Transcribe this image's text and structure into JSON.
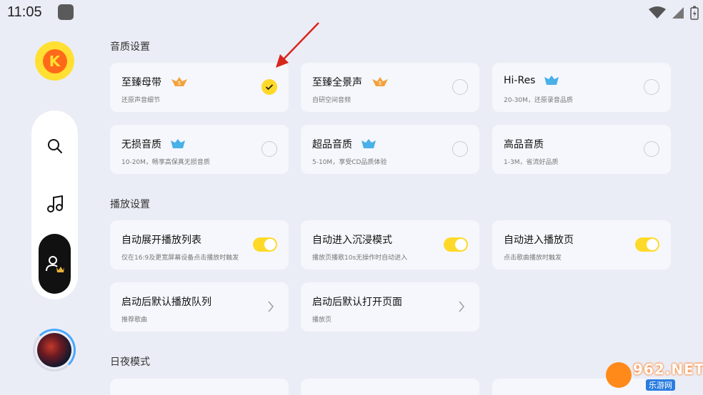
{
  "status_bar": {
    "time": "11:05"
  },
  "logo": {
    "letter": "K"
  },
  "sections": {
    "quality": "音质设置",
    "playback": "播放设置",
    "daynight": "日夜模式"
  },
  "quality_cards": [
    {
      "title": "至臻母带",
      "sub": "还原声音细节",
      "badge": "gold",
      "selected": true
    },
    {
      "title": "至臻全景声",
      "sub": "自研空间音频",
      "badge": "gold",
      "selected": false
    },
    {
      "title": "Hi-Res",
      "sub": "20-30M，还原录音品质",
      "badge": "blue",
      "selected": false
    },
    {
      "title": "无损音质",
      "sub": "10-20M，畅享高保真无损音质",
      "badge": "blue",
      "selected": false
    },
    {
      "title": "超品音质",
      "sub": "5-10M，享受CD品质体验",
      "badge": "blue",
      "selected": false
    },
    {
      "title": "高品音质",
      "sub": "1-3M，省流好品质",
      "badge": "none",
      "selected": false
    }
  ],
  "playback_cards": [
    {
      "title": "自动展开播放列表",
      "sub": "仅在16:9及更宽屏幕设备点击播放时触发",
      "control": "toggle",
      "on": true
    },
    {
      "title": "自动进入沉浸模式",
      "sub": "播放页播歌10s无操作时自动进入",
      "control": "toggle",
      "on": true
    },
    {
      "title": "自动进入播放页",
      "sub": "点击歌曲播放时触发",
      "control": "toggle",
      "on": true
    },
    {
      "title": "启动后默认播放队列",
      "sub": "推荐歌曲",
      "control": "chevron"
    },
    {
      "title": "启动后默认打开页面",
      "sub": "播放页",
      "control": "chevron"
    }
  ],
  "watermark": {
    "text": "962.NET",
    "sub": "乐游网"
  },
  "colors": {
    "accent": "#ffd92a",
    "background": "#ebedf6",
    "card": "#f6f7fc",
    "arrow": "#d9261c"
  }
}
